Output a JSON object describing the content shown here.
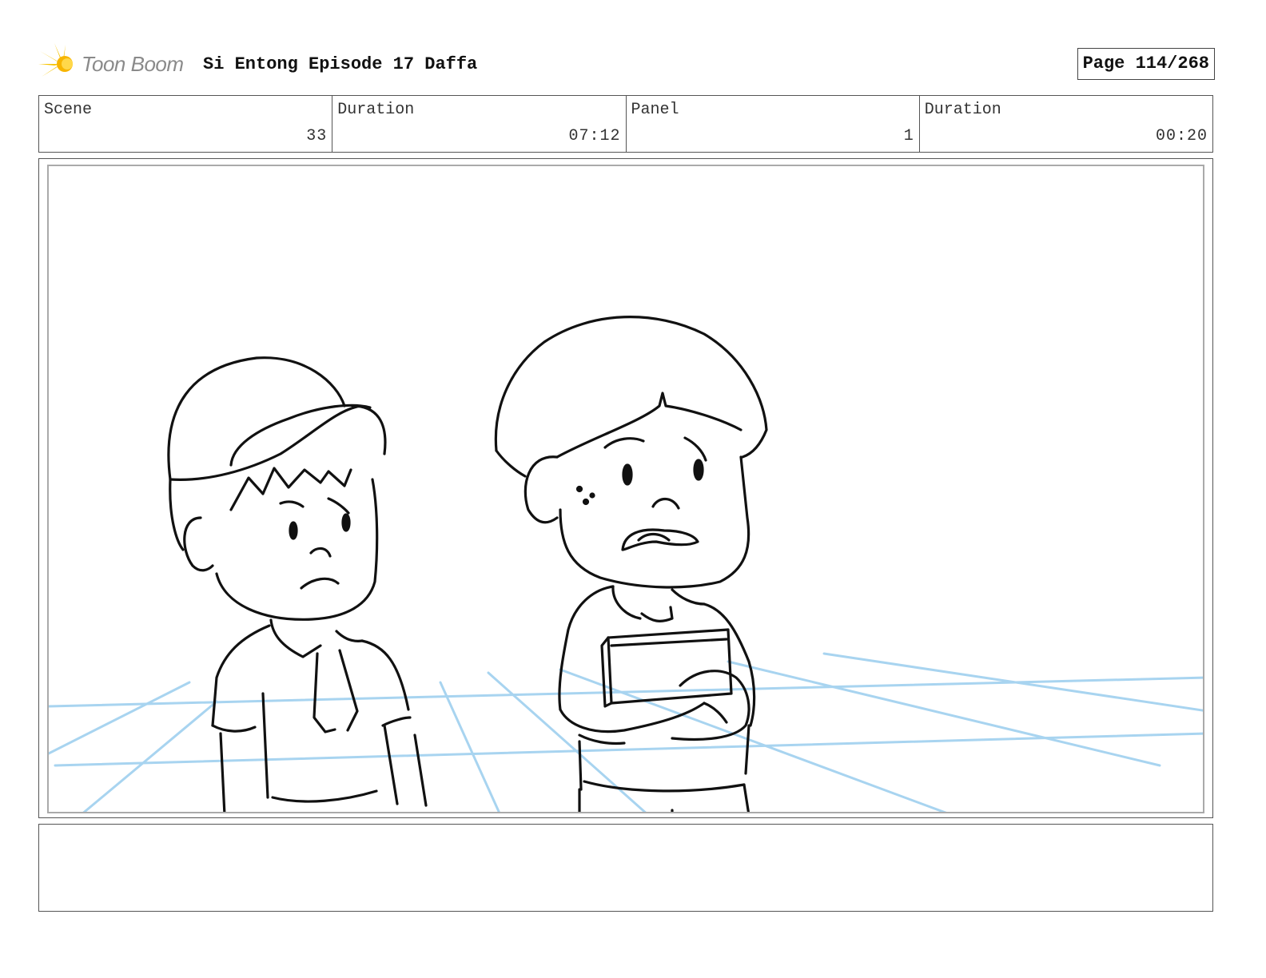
{
  "header": {
    "logo_text": "Toon Boom",
    "title": "Si Entong Episode 17 Daffa",
    "page_label": "Page 114/268"
  },
  "info": [
    {
      "label": "Scene",
      "value": "33"
    },
    {
      "label": "Duration",
      "value": "07:12"
    },
    {
      "label": "Panel",
      "value": "1"
    },
    {
      "label": "Duration",
      "value": "00:20"
    }
  ],
  "panel": {
    "image_label": "storyboard-sketch-two-boys",
    "colors": {
      "guide_lines": "#a8d4f0",
      "ink": "#111111",
      "logo_accent": "#f7c400"
    }
  },
  "notes": {
    "text": ""
  }
}
